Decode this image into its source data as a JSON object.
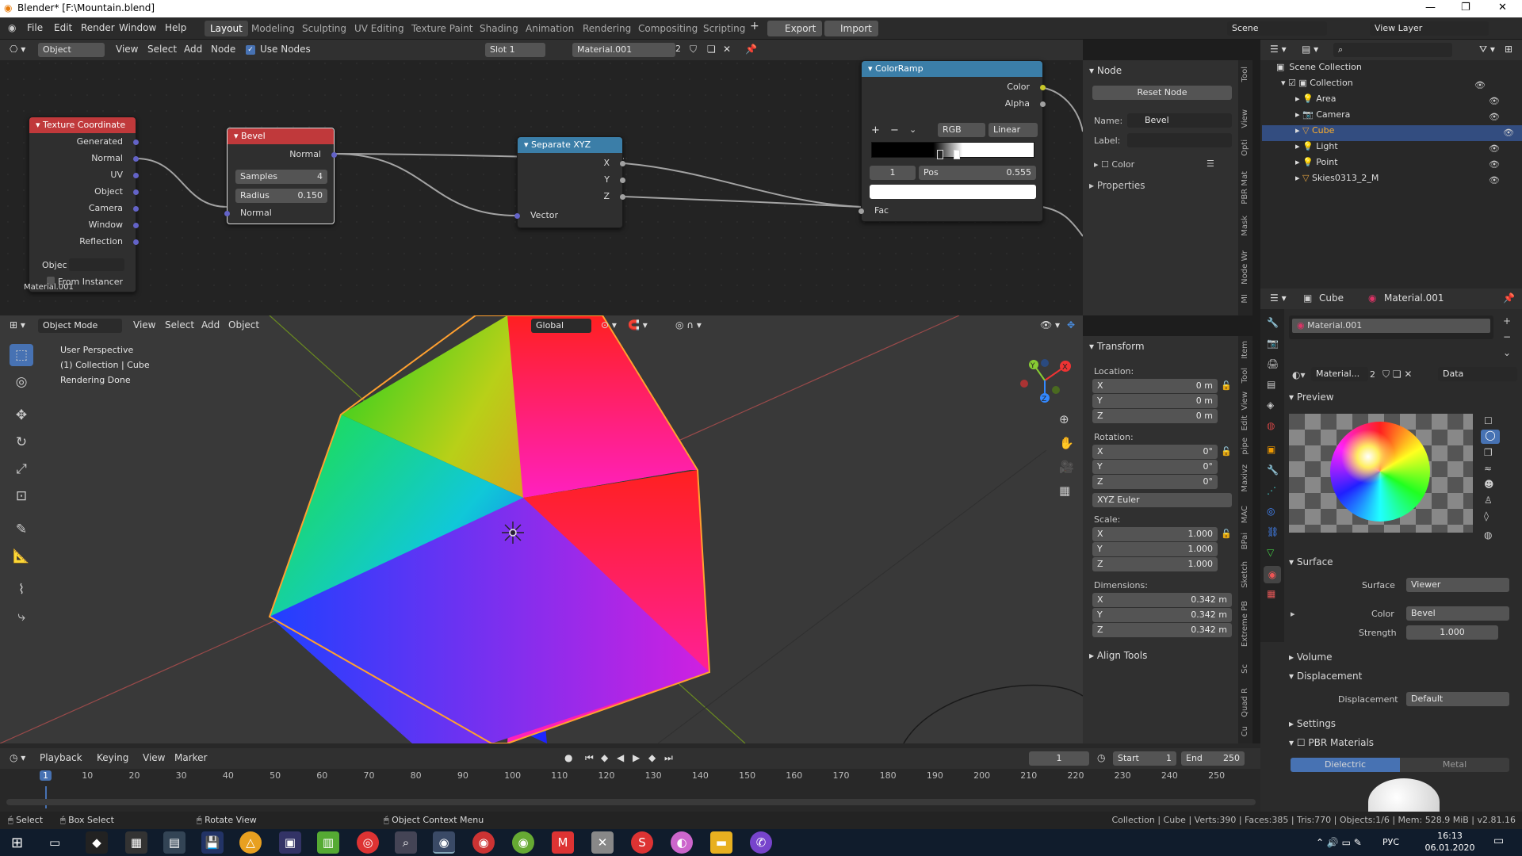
{
  "window": {
    "title": "Blender* [F:\\Mountain.blend]"
  },
  "menu": [
    "File",
    "Edit",
    "Render",
    "Window",
    "Help"
  ],
  "workspaces": [
    "Layout",
    "Modeling",
    "Sculpting",
    "UV Editing",
    "Texture Paint",
    "Shading",
    "Animation",
    "Rendering",
    "Compositing",
    "Scripting"
  ],
  "top_buttons": {
    "export": "Export",
    "import": "Import",
    "scene": "Scene",
    "view_layer": "View Layer"
  },
  "node_editor": {
    "header": {
      "mode": "Object",
      "view": "View",
      "select": "Select",
      "add": "Add",
      "node": "Node",
      "use_nodes": "Use Nodes",
      "slot": "Slot 1",
      "material": "Material.001",
      "users": "2"
    },
    "material_label": "Material.001",
    "nodes": {
      "texcoord": {
        "title": "Texture Coordinate",
        "outputs": [
          "Generated",
          "Normal",
          "UV",
          "Object",
          "Camera",
          "Window",
          "Reflection"
        ],
        "object_label": "Objec",
        "from_instancer": "From Instancer"
      },
      "bevel": {
        "title": "Bevel",
        "output": "Normal",
        "samples_label": "Samples",
        "samples": "4",
        "radius_label": "Radius",
        "radius": "0.150",
        "input": "Normal"
      },
      "separate": {
        "title": "Separate XYZ",
        "outputs": [
          "X",
          "Y",
          "Z"
        ],
        "input": "Vector"
      },
      "colorramp": {
        "title": "ColorRamp",
        "outputs": [
          "Color",
          "Alpha"
        ],
        "mode": "RGB",
        "interp": "Linear",
        "index": "1",
        "pos_label": "Pos",
        "pos": "0.555",
        "input": "Fac"
      }
    },
    "sidebar": {
      "section": "Node",
      "reset": "Reset Node",
      "name_label": "Name:",
      "name": "Bevel",
      "label_label": "Label:",
      "color": "Color",
      "properties": "Properties"
    },
    "tabs": [
      "Tool",
      "View",
      "Opti",
      "PBR Mat",
      "Mask",
      "Node Wr",
      "MI"
    ]
  },
  "outliner": {
    "root": "Scene Collection",
    "items": [
      {
        "name": "Collection"
      },
      {
        "name": "Area"
      },
      {
        "name": "Camera"
      },
      {
        "name": "Cube"
      },
      {
        "name": "Light"
      },
      {
        "name": "Point"
      },
      {
        "name": "Skies0313_2_M"
      }
    ]
  },
  "viewport": {
    "header": {
      "mode": "Object Mode",
      "view": "View",
      "select": "Select",
      "add": "Add",
      "object": "Object",
      "orientation": "Global"
    },
    "overlay": [
      "User Perspective",
      "(1) Collection | Cube",
      "Rendering Done"
    ],
    "tabs": [
      "Item",
      "Tool",
      "View",
      "Edit",
      "pipe",
      "Maxivz",
      "MAC",
      "BPai",
      "Sketch",
      "Extreme PB",
      "Sc",
      "Quad R",
      "Cu"
    ],
    "transform": {
      "section": "Transform",
      "location_label": "Location:",
      "location": [
        "0 m",
        "0 m",
        "0 m"
      ],
      "rotation_label": "Rotation:",
      "rotation": [
        "0°",
        "0°",
        "0°"
      ],
      "rotation_mode": "XYZ Euler",
      "scale_label": "Scale:",
      "scale": [
        "1.000",
        "1.000",
        "1.000"
      ],
      "dimensions_label": "Dimensions:",
      "dimensions": [
        "0.342 m",
        "0.342 m",
        "0.342 m"
      ],
      "axes": [
        "X",
        "Y",
        "Z"
      ],
      "align_tools": "Align Tools"
    }
  },
  "properties": {
    "object": "Cube",
    "material": "Material.001",
    "slot": "Material.001",
    "mat_short": "Material...",
    "users": "2",
    "link": "Data",
    "preview": "Preview",
    "surface_section": "Surface",
    "surface_label": "Surface",
    "surface_value": "Viewer",
    "color_label": "Color",
    "color_value": "Bevel",
    "strength_label": "Strength",
    "strength_value": "1.000",
    "volume": "Volume",
    "displacement_section": "Displacement",
    "displacement_label": "Displacement",
    "displacement_value": "Default",
    "settings": "Settings",
    "pbr": "PBR Materials",
    "dielectric": "Dielectric",
    "metal": "Metal"
  },
  "timeline": {
    "playback": "Playback",
    "keying": "Keying",
    "view": "View",
    "marker": "Marker",
    "current": "1",
    "start_label": "Start",
    "start": "1",
    "end_label": "End",
    "end": "250",
    "ticks": [
      "1",
      "10",
      "20",
      "30",
      "40",
      "50",
      "60",
      "70",
      "80",
      "90",
      "100",
      "110",
      "120",
      "130",
      "140",
      "150",
      "160",
      "170",
      "180",
      "190",
      "200",
      "210",
      "220",
      "230",
      "240",
      "250"
    ]
  },
  "statusbar": {
    "select": "Select",
    "box_select": "Box Select",
    "rotate": "Rotate View",
    "context": "Object Context Menu",
    "stats": "Collection | Cube | Verts:390 | Faces:385 | Tris:770 | Objects:1/6 | Mem: 528.9 MiB | v2.81.16"
  },
  "taskbar": {
    "lang": "РУС",
    "time": "16:13",
    "date": "06.01.2020"
  }
}
